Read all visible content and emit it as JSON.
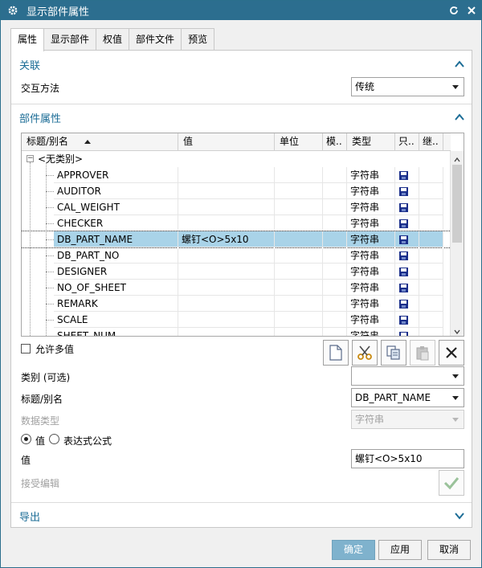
{
  "window": {
    "title": "显示部件属性"
  },
  "tabs": [
    {
      "label": "属性",
      "active": true
    },
    {
      "label": "显示部件",
      "active": false
    },
    {
      "label": "权值",
      "active": false
    },
    {
      "label": "部件文件",
      "active": false
    },
    {
      "label": "预览",
      "active": false
    }
  ],
  "association": {
    "section_label": "关联",
    "interaction_label": "交互方法",
    "interaction_value": "传统"
  },
  "part_attributes": {
    "section_label": "部件属性",
    "columns": [
      "标题/别名",
      "值",
      "单位",
      "模..",
      "类型",
      "只..",
      "继.."
    ],
    "group_label": "<无类别>",
    "rows": [
      {
        "name": "APPROVER",
        "value": "",
        "type": "字符串",
        "selected": false
      },
      {
        "name": "AUDITOR",
        "value": "",
        "type": "字符串",
        "selected": false
      },
      {
        "name": "CAL_WEIGHT",
        "value": "",
        "type": "字符串",
        "selected": false
      },
      {
        "name": "CHECKER",
        "value": "",
        "type": "字符串",
        "selected": false
      },
      {
        "name": "DB_PART_NAME",
        "value": "螺钉<O>5x10",
        "type": "字符串",
        "selected": true
      },
      {
        "name": "DB_PART_NO",
        "value": "",
        "type": "字符串",
        "selected": false
      },
      {
        "name": "DESIGNER",
        "value": "",
        "type": "字符串",
        "selected": false
      },
      {
        "name": "NO_OF_SHEET",
        "value": "",
        "type": "字符串",
        "selected": false
      },
      {
        "name": "REMARK",
        "value": "",
        "type": "字符串",
        "selected": false
      },
      {
        "name": "SCALE",
        "value": "",
        "type": "字符串",
        "selected": false
      },
      {
        "name": "SHEET_NUM",
        "value": "",
        "type": "字符串",
        "selected": false
      }
    ],
    "allow_multi_label": "允许多值",
    "category_label": "类别 (可选)",
    "category_value": "",
    "title_label": "标题/别名",
    "title_value": "DB_PART_NAME",
    "datatype_label": "数据类型",
    "datatype_value": "字符串",
    "radio_value_label": "值",
    "radio_expr_label": "表达式公式",
    "value_label": "值",
    "value_text": "螺钉<O>5x10",
    "accept_edit_label": "接受编辑"
  },
  "export": {
    "section_label": "导出"
  },
  "buttons": {
    "ok": "确定",
    "apply": "应用",
    "cancel": "取消"
  },
  "colors": {
    "titlebar": "#2c6e8f",
    "section_text": "#1b6c96",
    "selection": "#a9d3e8",
    "primary_button": "#7fb2cd"
  }
}
